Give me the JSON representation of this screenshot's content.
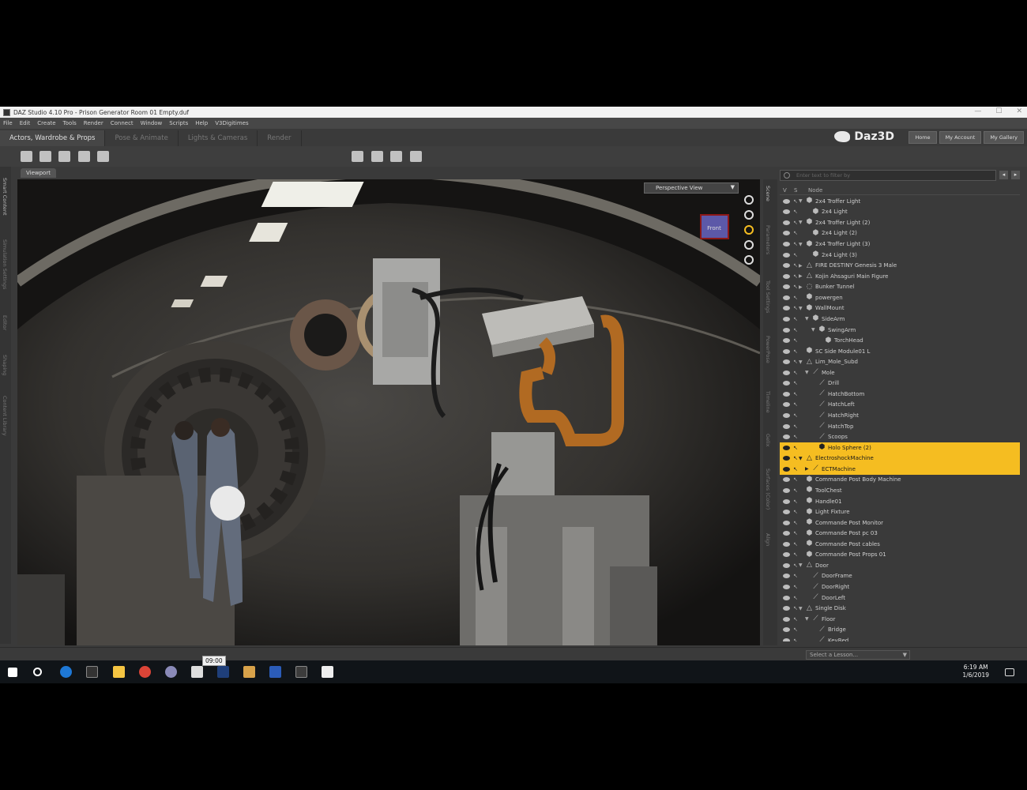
{
  "window": {
    "title": "DAZ Studio 4.10 Pro - Prison Generator Room 01 Empty.duf"
  },
  "menu": [
    "File",
    "Edit",
    "Create",
    "Tools",
    "Render",
    "Connect",
    "Window",
    "Scripts",
    "Help",
    "V3Digitimes"
  ],
  "tabs": [
    "Actors, Wardrobe & Props",
    "Pose & Animate",
    "Lights & Cameras",
    "Render"
  ],
  "brand": {
    "name": "Daz3D",
    "links": [
      "Home",
      "My Account",
      "My Gallery"
    ]
  },
  "left_tabs": [
    "Smart Content",
    "Simulation Settings",
    "Editor",
    "Shaping",
    "Content Library"
  ],
  "right_tabs": [
    "Scene",
    "Parameters",
    "Tool Settings",
    "PowerPose",
    "Timeline",
    "Gelix",
    "Surfaces (Color)",
    "Align"
  ],
  "viewport": {
    "tab_label": "Viewport",
    "camera": "Perspective View",
    "cube_face": "Front"
  },
  "scene": {
    "search_placeholder": "Enter text to filter by",
    "col_v": "V",
    "col_s": "S",
    "col_node": "Node",
    "nodes": [
      {
        "label": "2x4 Troffer Light",
        "depth": 0,
        "icon": "prop",
        "arrow": "▼"
      },
      {
        "label": "2x4 Light",
        "depth": 1,
        "icon": "prop",
        "arrow": ""
      },
      {
        "label": "2x4 Troffer Light (2)",
        "depth": 0,
        "icon": "prop",
        "arrow": "▼"
      },
      {
        "label": "2x4 Light (2)",
        "depth": 1,
        "icon": "prop",
        "arrow": ""
      },
      {
        "label": "2x4 Troffer Light (3)",
        "depth": 0,
        "icon": "prop",
        "arrow": "▼"
      },
      {
        "label": "2x4 Light (3)",
        "depth": 1,
        "icon": "prop",
        "arrow": ""
      },
      {
        "label": "FIRE DESTINY Genesis 3 Male",
        "depth": 0,
        "icon": "figure",
        "arrow": "▶"
      },
      {
        "label": "Kojin Ahsaguri Main Figure",
        "depth": 0,
        "icon": "figure",
        "arrow": "▶"
      },
      {
        "label": "Bunker Tunnel",
        "depth": 0,
        "icon": "group",
        "arrow": "▶"
      },
      {
        "label": "powergen",
        "depth": 0,
        "icon": "prop",
        "arrow": ""
      },
      {
        "label": "WallMount",
        "depth": 0,
        "icon": "prop",
        "arrow": "▼"
      },
      {
        "label": "SideArm",
        "depth": 1,
        "icon": "prop",
        "arrow": "▼"
      },
      {
        "label": "SwingArm",
        "depth": 2,
        "icon": "prop",
        "arrow": "▼"
      },
      {
        "label": "TorchHead",
        "depth": 3,
        "icon": "prop",
        "arrow": ""
      },
      {
        "label": "SC Side Module01 L",
        "depth": 0,
        "icon": "prop",
        "arrow": ""
      },
      {
        "label": "Lim_Mole_Subd",
        "depth": 0,
        "icon": "figure",
        "arrow": "▼"
      },
      {
        "label": "Mole",
        "depth": 1,
        "icon": "bone",
        "arrow": "▼"
      },
      {
        "label": "Drill",
        "depth": 2,
        "icon": "bone",
        "arrow": ""
      },
      {
        "label": "HatchBottom",
        "depth": 2,
        "icon": "bone",
        "arrow": ""
      },
      {
        "label": "HatchLeft",
        "depth": 2,
        "icon": "bone",
        "arrow": ""
      },
      {
        "label": "HatchRight",
        "depth": 2,
        "icon": "bone",
        "arrow": ""
      },
      {
        "label": "HatchTop",
        "depth": 2,
        "icon": "bone",
        "arrow": ""
      },
      {
        "label": "Scoops",
        "depth": 2,
        "icon": "bone",
        "arrow": ""
      },
      {
        "label": "Holo Sphere (2)",
        "depth": 2,
        "icon": "prop",
        "arrow": "",
        "selected": true
      },
      {
        "label": "ElectroshockMachine",
        "depth": 0,
        "icon": "figure",
        "arrow": "▼",
        "selected": true
      },
      {
        "label": "ECTMachine",
        "depth": 1,
        "icon": "bone",
        "arrow": "▶",
        "selected": true
      },
      {
        "label": "Commande Post Body Machine",
        "depth": 0,
        "icon": "prop",
        "arrow": ""
      },
      {
        "label": "ToolChest",
        "depth": 0,
        "icon": "prop",
        "arrow": ""
      },
      {
        "label": "Handle01",
        "depth": 0,
        "icon": "prop",
        "arrow": ""
      },
      {
        "label": "Light Fixture",
        "depth": 0,
        "icon": "prop",
        "arrow": ""
      },
      {
        "label": "Commande Post Monitor",
        "depth": 0,
        "icon": "prop",
        "arrow": ""
      },
      {
        "label": "Commande Post pc 03",
        "depth": 0,
        "icon": "prop",
        "arrow": ""
      },
      {
        "label": "Commande Post cables",
        "depth": 0,
        "icon": "prop",
        "arrow": ""
      },
      {
        "label": "Commande Post Props 01",
        "depth": 0,
        "icon": "prop",
        "arrow": ""
      },
      {
        "label": "Door",
        "depth": 0,
        "icon": "figure",
        "arrow": "▼"
      },
      {
        "label": "DoorFrame",
        "depth": 1,
        "icon": "bone",
        "arrow": ""
      },
      {
        "label": "DoorRight",
        "depth": 1,
        "icon": "bone",
        "arrow": ""
      },
      {
        "label": "DoorLeft",
        "depth": 1,
        "icon": "bone",
        "arrow": ""
      },
      {
        "label": "Single Disk",
        "depth": 0,
        "icon": "figure",
        "arrow": "▼"
      },
      {
        "label": "Floor",
        "depth": 1,
        "icon": "bone",
        "arrow": "▼"
      },
      {
        "label": "Bridge",
        "depth": 2,
        "icon": "bone",
        "arrow": ""
      },
      {
        "label": "KeyBed",
        "depth": 2,
        "icon": "bone",
        "arrow": ""
      }
    ]
  },
  "lesson": {
    "placeholder": "Select a Lesson..."
  },
  "taskbar": {
    "time": "6:19 AM",
    "date": "1/6/2019",
    "tooltip": "09:00"
  },
  "colors": {
    "selection": "#f5bd21",
    "panel": "#3a3a3a"
  }
}
